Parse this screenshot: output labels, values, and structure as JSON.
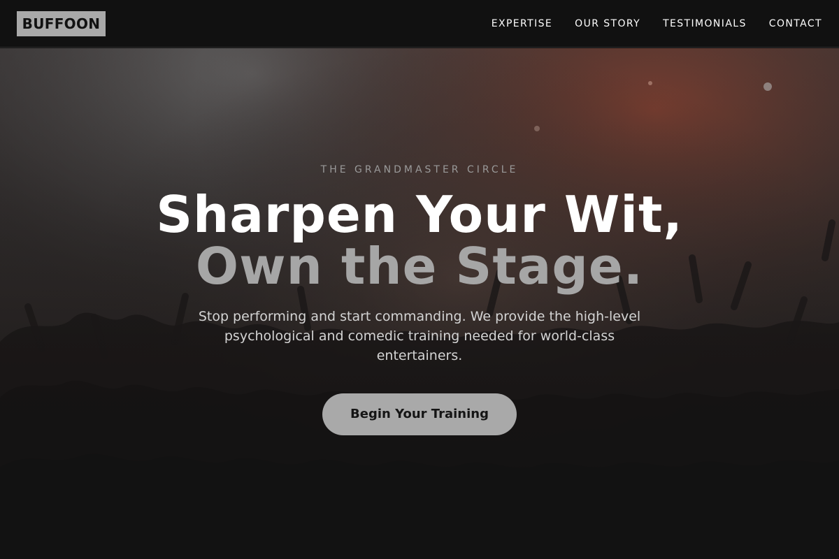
{
  "header": {
    "logo": "BUFFOON",
    "nav": [
      {
        "label": "EXPERTISE"
      },
      {
        "label": "OUR STORY"
      },
      {
        "label": "TESTIMONIALS"
      },
      {
        "label": "CONTACT"
      }
    ]
  },
  "hero": {
    "eyebrow": "THE GRANDMASTER CIRCLE",
    "title_line1": "Sharpen Your Wit,",
    "title_line2": "Own the Stage.",
    "subtitle": "Stop performing and start commanding. We provide the high-level psychological and comedic training needed for world-class entertainers.",
    "cta_label": "Begin Your Training"
  },
  "colors": {
    "nav_bg": "#111111",
    "logo_bg": "#a9a9a9",
    "accent_gray": "#a6a6a6",
    "cta_bg": "#a9a9a9",
    "stage_glow": "#7a3a2e"
  }
}
